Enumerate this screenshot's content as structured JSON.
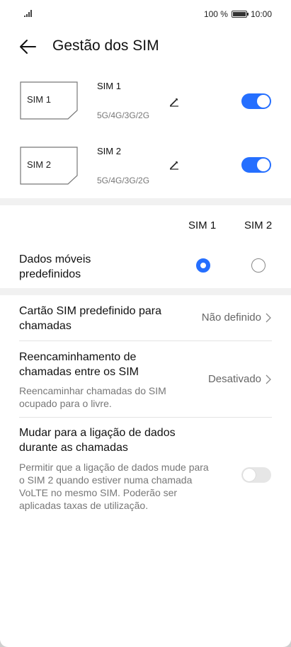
{
  "status_bar": {
    "battery_text": "100 %",
    "time": "10:00"
  },
  "header": {
    "title": "Gestão dos SIM",
    "back_icon": "arrow-left-icon"
  },
  "sims": [
    {
      "card_label": "SIM 1",
      "name": "SIM 1",
      "network": "5G/4G/3G/2G",
      "enabled": true
    },
    {
      "card_label": "SIM 2",
      "name": "SIM 2",
      "network": "5G/4G/3G/2G",
      "enabled": true
    }
  ],
  "columns": {
    "sim1": "SIM 1",
    "sim2": "SIM 2"
  },
  "default_data": {
    "label": "Dados móveis predefinidos",
    "selected": "SIM 1"
  },
  "default_call_sim": {
    "label": "Cartão SIM predefinido para chamadas",
    "value": "Não definido"
  },
  "call_forwarding": {
    "label": "Reencaminhamento de chamadas entre os SIM",
    "value": "Desativado",
    "description": "Reencaminhar chamadas do SIM ocupado para o livre."
  },
  "data_during_calls": {
    "label": "Mudar para a ligação de dados durante as chamadas",
    "description": "Permitir que a ligação de dados mude para o SIM 2 quando estiver numa chamada VoLTE no mesmo SIM. Poderão ser aplicadas taxas de utilização.",
    "enabled": false
  },
  "colors": {
    "accent": "#256fff",
    "section_gap": "#f1f1f1"
  }
}
